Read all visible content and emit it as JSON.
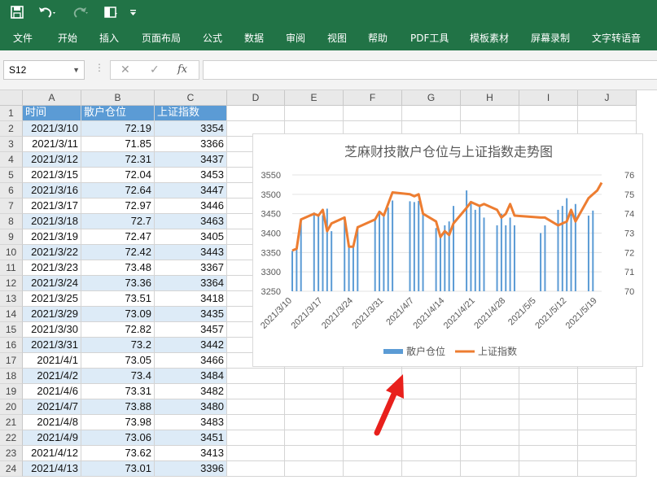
{
  "toolbar": {
    "save_icon": "save-icon",
    "undo_icon": "undo-icon",
    "redo_icon": "redo-icon",
    "form_icon": "form-icon",
    "customize_icon": "customize-icon"
  },
  "menu": [
    "文件",
    "开始",
    "插入",
    "页面布局",
    "公式",
    "数据",
    "审阅",
    "视图",
    "帮助",
    "PDF工具",
    "模板素材",
    "屏幕录制",
    "文字转语音"
  ],
  "formula_bar": {
    "name_box": "S12",
    "cancel": "✕",
    "enter": "✓",
    "fx": "fx",
    "formula": ""
  },
  "columns": [
    "A",
    "B",
    "C",
    "D",
    "E",
    "F",
    "G",
    "H",
    "I",
    "J"
  ],
  "row_numbers": [
    "1",
    "2",
    "3",
    "4",
    "5",
    "6",
    "7",
    "8",
    "9",
    "10",
    "11",
    "12",
    "13",
    "14",
    "15",
    "16",
    "17",
    "18",
    "19",
    "20",
    "21",
    "22",
    "23",
    "24"
  ],
  "headers": [
    "时间",
    "散户仓位",
    "上证指数"
  ],
  "rows": [
    [
      "2021/3/10",
      "72.19",
      "3354"
    ],
    [
      "2021/3/11",
      "71.85",
      "3366"
    ],
    [
      "2021/3/12",
      "72.31",
      "3437"
    ],
    [
      "2021/3/15",
      "72.04",
      "3453"
    ],
    [
      "2021/3/16",
      "72.64",
      "3447"
    ],
    [
      "2021/3/17",
      "72.97",
      "3446"
    ],
    [
      "2021/3/18",
      "72.7",
      "3463"
    ],
    [
      "2021/3/19",
      "72.47",
      "3405"
    ],
    [
      "2021/3/22",
      "72.42",
      "3443"
    ],
    [
      "2021/3/23",
      "73.48",
      "3367"
    ],
    [
      "2021/3/24",
      "73.36",
      "3364"
    ],
    [
      "2021/3/25",
      "73.51",
      "3418"
    ],
    [
      "2021/3/29",
      "73.09",
      "3435"
    ],
    [
      "2021/3/30",
      "72.82",
      "3457"
    ],
    [
      "2021/3/31",
      "73.2",
      "3442"
    ],
    [
      "2021/4/1",
      "73.05",
      "3466"
    ],
    [
      "2021/4/2",
      "73.4",
      "3484"
    ],
    [
      "2021/4/6",
      "73.31",
      "3482"
    ],
    [
      "2021/4/7",
      "73.88",
      "3480"
    ],
    [
      "2021/4/8",
      "73.98",
      "3483"
    ],
    [
      "2021/4/9",
      "73.06",
      "3451"
    ],
    [
      "2021/4/12",
      "73.62",
      "3413"
    ],
    [
      "2021/4/13",
      "73.01",
      "3396"
    ]
  ],
  "chart_data": {
    "type": "bar",
    "title": "芝麻财技散户仓位与上证指数走势图",
    "x_tick_labels": [
      "2021/3/10",
      "2021/3/17",
      "2021/3/24",
      "2021/3/31",
      "2021/4/7",
      "2021/4/14",
      "2021/4/21",
      "2021/4/28",
      "2021/5/5",
      "2021/5/12",
      "2021/5/19"
    ],
    "x_range": [
      "2021/3/10",
      "2021/5/20"
    ],
    "y_left_ticks": [
      "3250",
      "3300",
      "3350",
      "3400",
      "3450",
      "3500",
      "3550"
    ],
    "y_right_ticks": [
      "70",
      "71",
      "72",
      "73",
      "74",
      "75",
      "76"
    ],
    "ylim_left": [
      3250,
      3550
    ],
    "ylim_right": [
      70,
      76
    ],
    "legend_position": "bottom",
    "series": [
      {
        "name": "散户仓位",
        "type": "bar",
        "axis": "left",
        "color": "#5b9bd5",
        "x": [
          "2021/3/10",
          "2021/3/11",
          "2021/3/12",
          "2021/3/15",
          "2021/3/16",
          "2021/3/17",
          "2021/3/18",
          "2021/3/19",
          "2021/3/22",
          "2021/3/23",
          "2021/3/24",
          "2021/3/25",
          "2021/3/29",
          "2021/3/30",
          "2021/3/31",
          "2021/4/1",
          "2021/4/2",
          "2021/4/6",
          "2021/4/7",
          "2021/4/8",
          "2021/4/9",
          "2021/4/12",
          "2021/4/13",
          "2021/4/14",
          "2021/4/15",
          "2021/4/16",
          "2021/4/19",
          "2021/4/20",
          "2021/4/21",
          "2021/4/22",
          "2021/4/23",
          "2021/4/26",
          "2021/4/27",
          "2021/4/28",
          "2021/4/29",
          "2021/4/30",
          "2021/5/6",
          "2021/5/7",
          "2021/5/10",
          "2021/5/11",
          "2021/5/12",
          "2021/5/13",
          "2021/5/14",
          "2021/5/17",
          "2021/5/18"
        ],
        "values": [
          3354,
          3366,
          3437,
          3453,
          3447,
          3446,
          3463,
          3405,
          3443,
          3367,
          3364,
          3418,
          3435,
          3457,
          3442,
          3466,
          3484,
          3482,
          3480,
          3483,
          3451,
          3413,
          3396,
          3420,
          3430,
          3470,
          3510,
          3480,
          3460,
          3470,
          3440,
          3420,
          3450,
          3420,
          3440,
          3420,
          3400,
          3420,
          3460,
          3470,
          3490,
          3460,
          3475,
          3445,
          3458
        ]
      },
      {
        "name": "上证指数",
        "type": "line",
        "axis": "right",
        "color": "#ed7d31",
        "x": [
          "2021/3/10",
          "2021/3/11",
          "2021/3/12",
          "2021/3/15",
          "2021/3/16",
          "2021/3/17",
          "2021/3/18",
          "2021/3/19",
          "2021/3/22",
          "2021/3/23",
          "2021/3/24",
          "2021/3/25",
          "2021/3/29",
          "2021/3/30",
          "2021/3/31",
          "2021/4/1",
          "2021/4/2",
          "2021/4/6",
          "2021/4/7",
          "2021/4/8",
          "2021/4/9",
          "2021/4/12",
          "2021/4/13",
          "2021/4/14",
          "2021/4/15",
          "2021/4/16",
          "2021/4/19",
          "2021/4/20",
          "2021/4/21",
          "2021/4/22",
          "2021/4/23",
          "2021/4/26",
          "2021/4/27",
          "2021/4/28",
          "2021/4/29",
          "2021/4/30",
          "2021/5/6",
          "2021/5/7",
          "2021/5/10",
          "2021/5/11",
          "2021/5/12",
          "2021/5/13",
          "2021/5/14",
          "2021/5/17",
          "2021/5/18",
          "2021/5/19",
          "2021/5/20"
        ],
        "values": [
          72.1,
          72.2,
          73.7,
          74.0,
          73.9,
          74.2,
          73.1,
          73.5,
          73.8,
          72.3,
          72.3,
          73.3,
          73.7,
          74.1,
          73.9,
          74.5,
          75.1,
          75.0,
          74.9,
          75.0,
          74.0,
          73.6,
          72.8,
          73.1,
          72.9,
          73.5,
          74.3,
          74.6,
          74.5,
          74.4,
          74.5,
          74.2,
          73.8,
          74.0,
          74.5,
          73.9,
          73.8,
          73.8,
          73.4,
          73.5,
          73.6,
          74.2,
          73.6,
          74.8,
          75.0,
          75.2,
          75.6
        ]
      }
    ]
  }
}
